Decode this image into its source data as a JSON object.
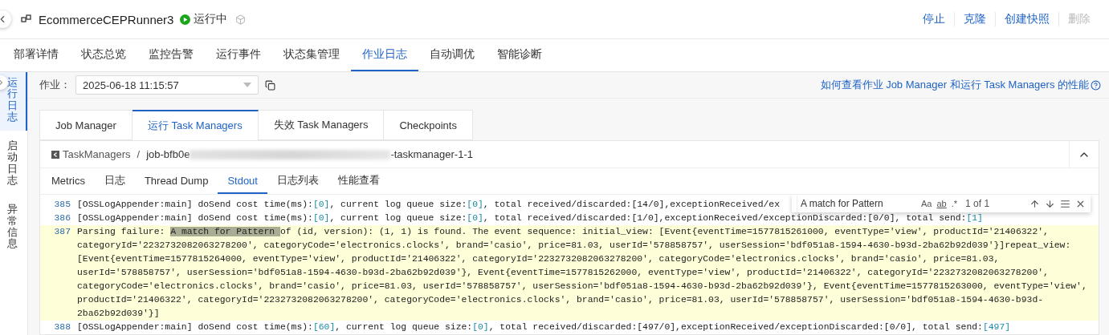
{
  "header": {
    "title": "EcommerceCEPRunner3",
    "status": "运行中",
    "actions": [
      {
        "label": "停止",
        "disabled": false
      },
      {
        "label": "克隆",
        "disabled": false
      },
      {
        "label": "创建快照",
        "disabled": false
      },
      {
        "label": "删除",
        "disabled": true
      }
    ]
  },
  "tabs": [
    {
      "label": "部署详情",
      "selected": false
    },
    {
      "label": "状态总览",
      "selected": false
    },
    {
      "label": "监控告警",
      "selected": false
    },
    {
      "label": "运行事件",
      "selected": false
    },
    {
      "label": "状态集管理",
      "selected": false
    },
    {
      "label": "作业日志",
      "selected": true
    },
    {
      "label": "自动调优",
      "selected": false
    },
    {
      "label": "智能诊断",
      "selected": false
    }
  ],
  "side_tabs": [
    {
      "label": "运行日志",
      "selected": true
    },
    {
      "label": "启动日志",
      "selected": false
    },
    {
      "label": "异常信息",
      "selected": false
    }
  ],
  "job_select": {
    "label": "作业：",
    "value": "2025-06-18 11:15:57"
  },
  "help_link": "如何查看作业 Job Manager 和运行 Task Managers 的性能",
  "manager_tabs": [
    {
      "label": "Job Manager",
      "selected": false
    },
    {
      "label": "运行 Task Managers",
      "selected": true
    },
    {
      "label": "失效 Task Managers",
      "selected": false
    },
    {
      "label": "Checkpoints",
      "selected": false
    }
  ],
  "breadcrumb": {
    "parent": "TaskManagers",
    "separator": "/",
    "current_start": "job-bfb0e",
    "current_end": "-taskmanager-1-1"
  },
  "sub_tabs": [
    {
      "label": "Metrics",
      "selected": false
    },
    {
      "label": "日志",
      "selected": false
    },
    {
      "label": "Thread Dump",
      "selected": false
    },
    {
      "label": "Stdout",
      "selected": true
    },
    {
      "label": "日志列表",
      "selected": false
    },
    {
      "label": "性能查看",
      "selected": false
    }
  ],
  "search": {
    "value": "A match for Pattern",
    "options": [
      "Aa",
      "ab",
      ".*"
    ],
    "count": "1 of 1"
  },
  "log_lines": [
    {
      "number": "385",
      "highlighted": false,
      "segments": [
        {
          "kind": "plain",
          "text": "[OSSLogAppender:main] doSend cost time(ms):"
        },
        {
          "kind": "value",
          "text": "[0]"
        },
        {
          "kind": "plain",
          "text": ", current log queue size:"
        },
        {
          "kind": "value",
          "text": "[0]"
        },
        {
          "kind": "plain",
          "text": ", total received/discarded:[14/0],exceptionReceived/ex"
        }
      ]
    },
    {
      "number": "386",
      "highlighted": false,
      "segments": [
        {
          "kind": "plain",
          "text": "[OSSLogAppender:main] doSend cost time(ms):"
        },
        {
          "kind": "value",
          "text": "[0]"
        },
        {
          "kind": "plain",
          "text": ", current log queue size:"
        },
        {
          "kind": "value",
          "text": "[0]"
        },
        {
          "kind": "plain",
          "text": ", total received/discarded:[1/0],exceptionReceived/exceptionDiscarded:[0/0], total send:"
        },
        {
          "kind": "value",
          "text": "[1]"
        }
      ]
    },
    {
      "number": "387",
      "highlighted": true,
      "segments": [
        {
          "kind": "plain",
          "text": "Parsing failure: "
        },
        {
          "kind": "match",
          "text": "A match for Pattern "
        },
        {
          "kind": "plain",
          "text": "of (id, version): (1, 1) is found. The event sequence: initial_view: [Event{eventTime=1577815261000, eventType='view', productId='21406322', categoryId='2232732082063278200', categoryCode='electronics.clocks', brand='casio', price=81.03, userId='578858757', userSession='bdf051a8-1594-4630-b93d-2ba62b92d039'}]repeat_view: [Event{eventTime=1577815264000, eventType='view', productId='21406322', categoryId='2232732082063278200', categoryCode='electronics.clocks', brand='casio', price=81.03, userId='578858757', userSession='bdf051a8-1594-4630-b93d-2ba62b92d039'}, Event{eventTime=1577815262000, eventType='view', productId='21406322', categoryId='2232732082063278200', categoryCode='electronics.clocks', brand='casio', price=81.03, userId='578858757', userSession='bdf051a8-1594-4630-b93d-2ba62b92d039'}, Event{eventTime=1577815263000, eventType='view', productId='21406322', categoryId='2232732082063278200', categoryCode='electronics.clocks', brand='casio', price=81.03, userId='578858757', userSession='bdf051a8-1594-4630-b93d-2ba62b92d039'}]"
        }
      ]
    },
    {
      "number": "388",
      "highlighted": false,
      "segments": [
        {
          "kind": "plain",
          "text": "[OSSLogAppender:main] doSend cost time(ms):"
        },
        {
          "kind": "value",
          "text": "[60]"
        },
        {
          "kind": "plain",
          "text": ", current log queue size:"
        },
        {
          "kind": "value",
          "text": "[0]"
        },
        {
          "kind": "plain",
          "text": ", total received/discarded:[497/0],exceptionReceived/exceptionDiscarded:[0/0], total send:"
        },
        {
          "kind": "value",
          "text": "[497]"
        }
      ]
    }
  ]
}
